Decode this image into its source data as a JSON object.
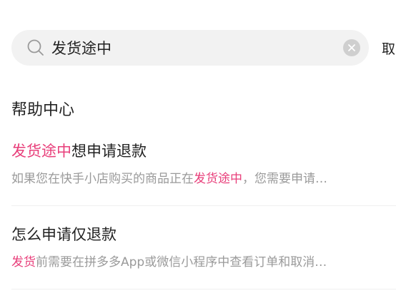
{
  "colors": {
    "highlight": "#e83e7a",
    "search_bg": "#f2f2f2",
    "muted_text": "#9a9a9a"
  },
  "search": {
    "value": "发货途中",
    "search_icon": "search-icon",
    "clear_icon": "clear-icon"
  },
  "cancel_label": "取",
  "section_title": "帮助中心",
  "results": [
    {
      "title_highlight": "发货途中",
      "title_rest": "想申请退款",
      "snippet_before": "如果您在快手小店购买的商品正在",
      "snippet_highlight": "发货途中",
      "snippet_after": "，您需要申请…"
    },
    {
      "title": "怎么申请仅退款",
      "snippet_highlight": "发货",
      "snippet_after": "前需要在拼多多App或微信小程序中查看订单和取消…"
    }
  ]
}
